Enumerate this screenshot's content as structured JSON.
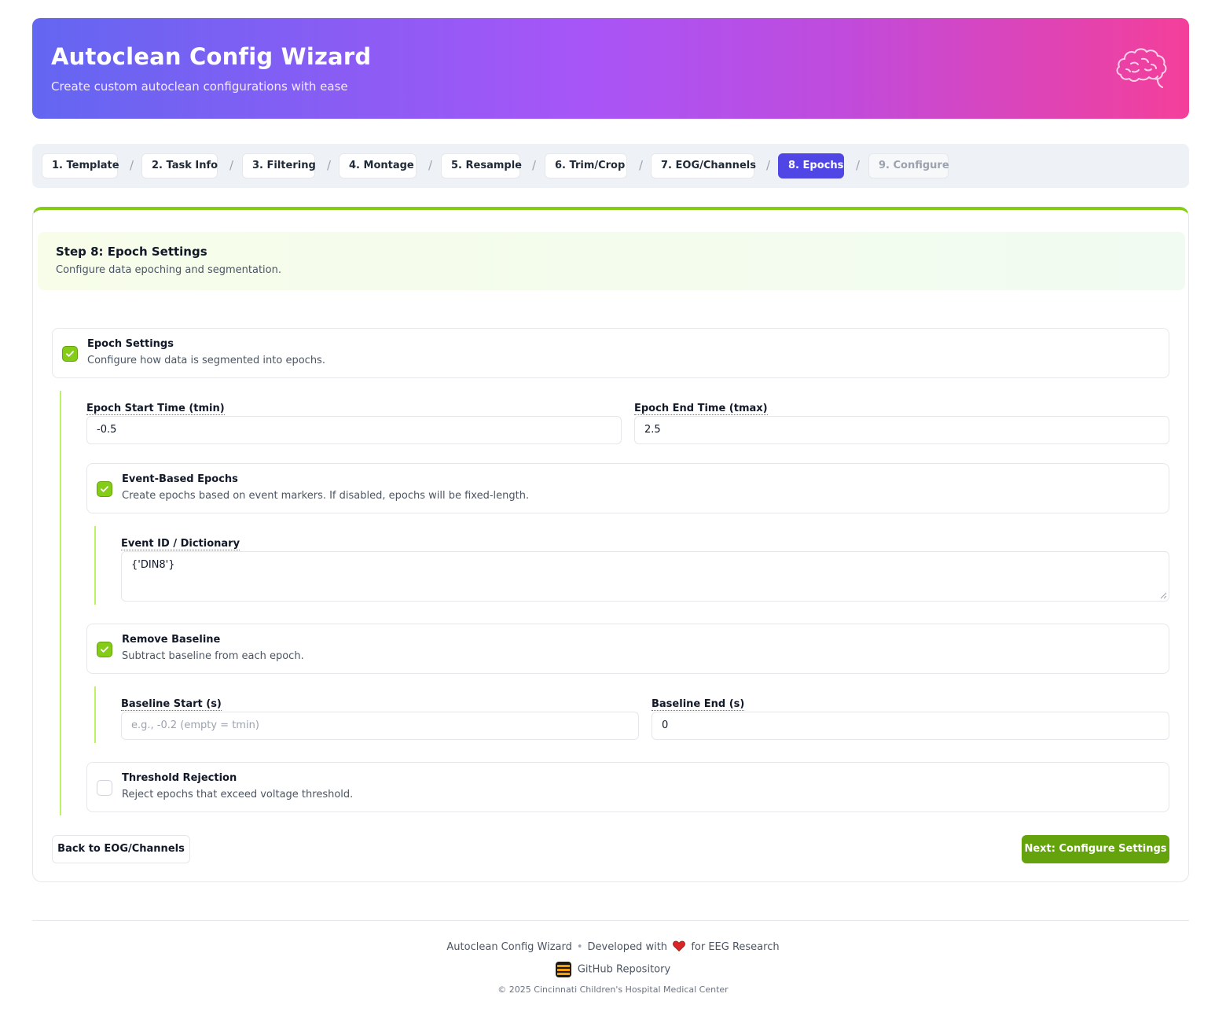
{
  "header": {
    "title": "Autoclean Config Wizard",
    "subtitle": "Create custom autoclean configurations with ease",
    "icon": "brain-icon"
  },
  "steps": [
    {
      "label": "1. Template",
      "state": "done"
    },
    {
      "label": "2. Task Info",
      "state": "done"
    },
    {
      "label": "3. Filtering",
      "state": "done"
    },
    {
      "label": "4. Montage",
      "state": "done"
    },
    {
      "label": "5. Resample",
      "state": "done"
    },
    {
      "label": "6. Trim/Crop",
      "state": "done"
    },
    {
      "label": "7. EOG/Channels",
      "state": "done"
    },
    {
      "label": "8. Epochs",
      "state": "active"
    },
    {
      "label": "9. Configure",
      "state": "disabled"
    }
  ],
  "step_separator": "/",
  "section": {
    "title": "Step 8: Epoch Settings",
    "description": "Configure data epoching and segmentation."
  },
  "epoch_settings": {
    "label": "Epoch Settings",
    "hint": "Configure how data is segmented into epochs.",
    "checked": true
  },
  "tmin": {
    "label": "Epoch Start Time (tmin)",
    "value": "-0.5"
  },
  "tmax": {
    "label": "Epoch End Time (tmax)",
    "value": "2.5"
  },
  "event_based": {
    "label": "Event-Based Epochs",
    "hint": "Create epochs based on event markers. If disabled, epochs will be fixed-length.",
    "checked": true
  },
  "event_id": {
    "label": "Event ID / Dictionary",
    "value": "{'DIN8'}"
  },
  "remove_baseline": {
    "label": "Remove Baseline",
    "hint": "Subtract baseline from each epoch.",
    "checked": true
  },
  "baseline_start": {
    "label": "Baseline Start (s)",
    "value": "",
    "placeholder": "e.g., -0.2 (empty = tmin)"
  },
  "baseline_end": {
    "label": "Baseline End (s)",
    "value": "0"
  },
  "threshold": {
    "label": "Threshold Rejection",
    "hint": "Reject epochs that exceed voltage threshold.",
    "checked": false
  },
  "buttons": {
    "back": "Back to EOG/Channels",
    "next": "Next: Configure Settings"
  },
  "footer": {
    "app_name": "Autoclean Config Wizard",
    "developed_prefix": "Developed with",
    "developed_suffix": "for EEG Research",
    "github": "GitHub Repository",
    "copyright": "© 2025 Cincinnati Children's Hospital Medical Center"
  },
  "colors": {
    "accent_active_step": "#4f46e5",
    "success_green": "#84cc16",
    "next_button": "#65a30d"
  }
}
